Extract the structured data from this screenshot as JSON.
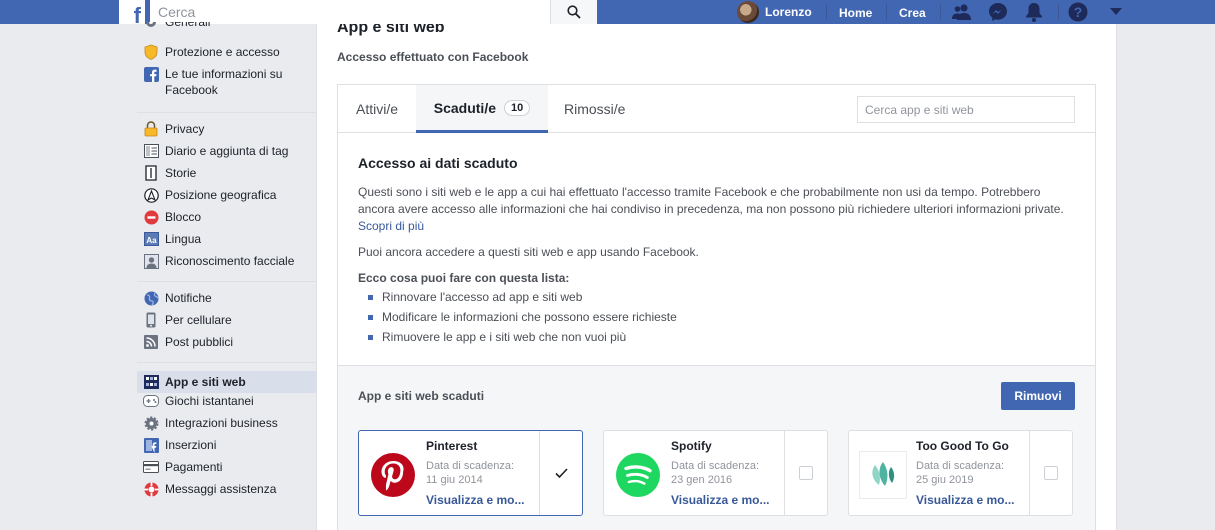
{
  "topbar": {
    "search_placeholder": "Cerca",
    "user_name": "Lorenzo",
    "home_label": "Home",
    "create_label": "Crea"
  },
  "sidebar": {
    "items": [
      {
        "label": "Generali",
        "icon": "gear-icon"
      },
      {
        "label": "Protezione e accesso",
        "icon": "shield-icon"
      },
      {
        "label": "Le tue informazioni su Facebook",
        "icon": "facebook-icon"
      },
      {
        "label": "Privacy",
        "icon": "lock-icon"
      },
      {
        "label": "Diario e aggiunta di tag",
        "icon": "timeline-icon"
      },
      {
        "label": "Storie",
        "icon": "book-icon"
      },
      {
        "label": "Posizione geografica",
        "icon": "location-icon"
      },
      {
        "label": "Blocco",
        "icon": "block-icon"
      },
      {
        "label": "Lingua",
        "icon": "language-icon"
      },
      {
        "label": "Riconoscimento facciale",
        "icon": "face-icon"
      },
      {
        "label": "Notifiche",
        "icon": "globe-icon"
      },
      {
        "label": "Per cellulare",
        "icon": "mobile-icon"
      },
      {
        "label": "Post pubblici",
        "icon": "rss-icon"
      },
      {
        "label": "App e siti web",
        "icon": "apps-icon"
      },
      {
        "label": "Giochi istantanei",
        "icon": "gamepad-icon"
      },
      {
        "label": "Integrazioni business",
        "icon": "business-gear-icon"
      },
      {
        "label": "Inserzioni",
        "icon": "ads-icon"
      },
      {
        "label": "Pagamenti",
        "icon": "card-icon"
      },
      {
        "label": "Messaggi assistenza",
        "icon": "lifebuoy-icon"
      }
    ]
  },
  "main": {
    "title": "App e siti web",
    "subtitle": "Accesso effettuato con Facebook",
    "tabs": [
      {
        "label": "Attivi/e"
      },
      {
        "label": "Scaduti/e",
        "count": "10"
      },
      {
        "label": "Rimossi/e"
      }
    ],
    "search_placeholder": "Cerca app e siti web",
    "info": {
      "heading": "Accesso ai dati scaduto",
      "para1": "Questi sono i siti web e le app a cui hai effettuato l'accesso tramite Facebook e che probabilmente non usi da tempo. Potrebbero ancora avere accesso alle informazioni che hai condiviso in precedenza, ma non possono più richiedere ulteriori informazioni private.",
      "learn_more": "Scopri di più",
      "para2": "Puoi ancora accedere a questi siti web e app usando Facebook.",
      "para3": "Ecco cosa puoi fare con questa lista:",
      "bullets": [
        "Rinnovare l'accesso ad app e siti web",
        "Modificare le informazioni che possono essere richieste",
        "Rimuovere le app e i siti web che non vuoi più"
      ]
    },
    "expired": {
      "title": "App e siti web scaduti",
      "remove_label": "Rimuovi",
      "apps": [
        {
          "name": "Pinterest",
          "exp_label": "Data di scadenza:",
          "date": "11 giu 2014",
          "link": "Visualizza e mo...",
          "checked": true,
          "color": "#bd081c"
        },
        {
          "name": "Spotify",
          "exp_label": "Data di scadenza:",
          "date": "23 gen 2016",
          "link": "Visualizza e mo...",
          "checked": false,
          "color": "#1ed760"
        },
        {
          "name": "Too Good To Go",
          "exp_label": "Data di scadenza:",
          "date": "25 giu 2019",
          "link": "Visualizza e mo...",
          "checked": false,
          "color": "#6ac3b4"
        }
      ]
    }
  }
}
